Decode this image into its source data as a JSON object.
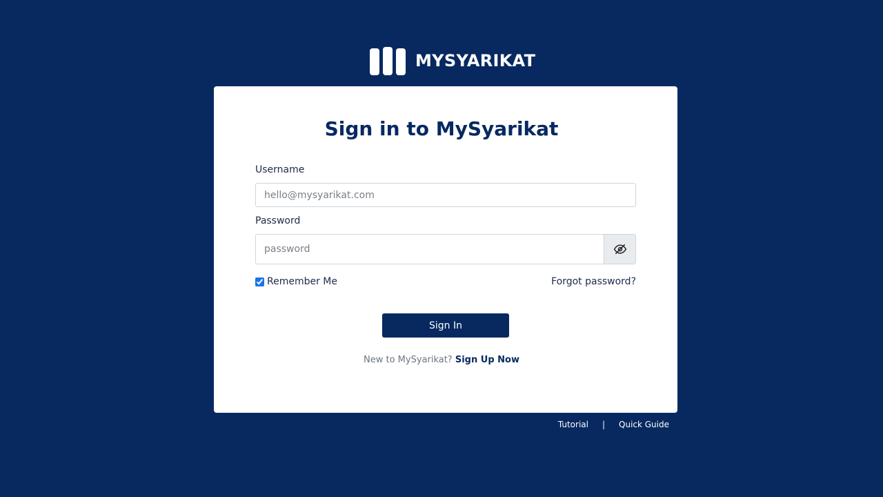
{
  "brand": {
    "logo_text": "MYSYARIKAT",
    "primary_color": "#072960"
  },
  "login": {
    "title_prefix": "Sign in to",
    "title_brand": "MySyarikat",
    "username_label": "Username",
    "username_placeholder": "hello@mysyarikat.com",
    "password_label": "Password",
    "password_placeholder": "password",
    "toggle_icon": "eye-slash-icon",
    "remember_label": "Remember Me",
    "remember_checked": true,
    "forgot_label": "Forgot password?",
    "signin_label": "Sign In",
    "signup_prompt": "New to MySyarikat?",
    "signup_link": "Sign Up Now"
  },
  "footer": {
    "tutorial": "Tutorial",
    "separator": "|",
    "quick_guide": "Quick Guide"
  }
}
